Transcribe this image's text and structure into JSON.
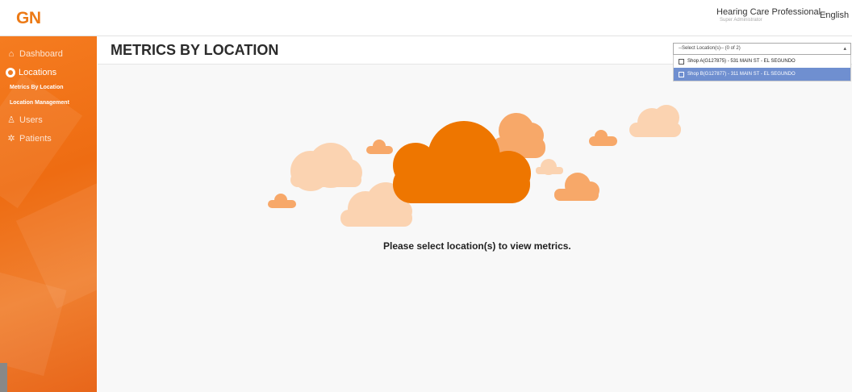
{
  "header": {
    "logo": "GN",
    "user_name": "Hearing Care Professional",
    "user_role": "Super Administrator",
    "language": "English",
    "caret": "⌄"
  },
  "sidebar": {
    "items": [
      {
        "label": "Dashboard",
        "icon": "home-icon"
      },
      {
        "label": "Locations",
        "icon": "location-icon"
      },
      {
        "label": "Users",
        "icon": "users-icon"
      },
      {
        "label": "Patients",
        "icon": "patients-icon"
      }
    ],
    "subitems": [
      {
        "label": "Metrics By Location"
      },
      {
        "label": "Location Management"
      }
    ]
  },
  "main": {
    "title": "METRICS BY LOCATION",
    "message": "Please select location(s) to view metrics."
  },
  "location_select": {
    "value": "--Select Location(s)-- (0 of 2)",
    "options": [
      {
        "label": "Shop A(G127875) - 531 MAIN ST - EL SEGUNDO",
        "selected": false
      },
      {
        "label": "Shop B(G127877) - 311 MAIN ST - EL SEGUNDO",
        "selected": true
      }
    ]
  },
  "colors": {
    "accent": "#EC7A16",
    "cloud_dark": "#EE7600",
    "cloud_mid": "#F7A869",
    "cloud_light": "#FBD3B1",
    "highlight": "#6F8FD0"
  }
}
